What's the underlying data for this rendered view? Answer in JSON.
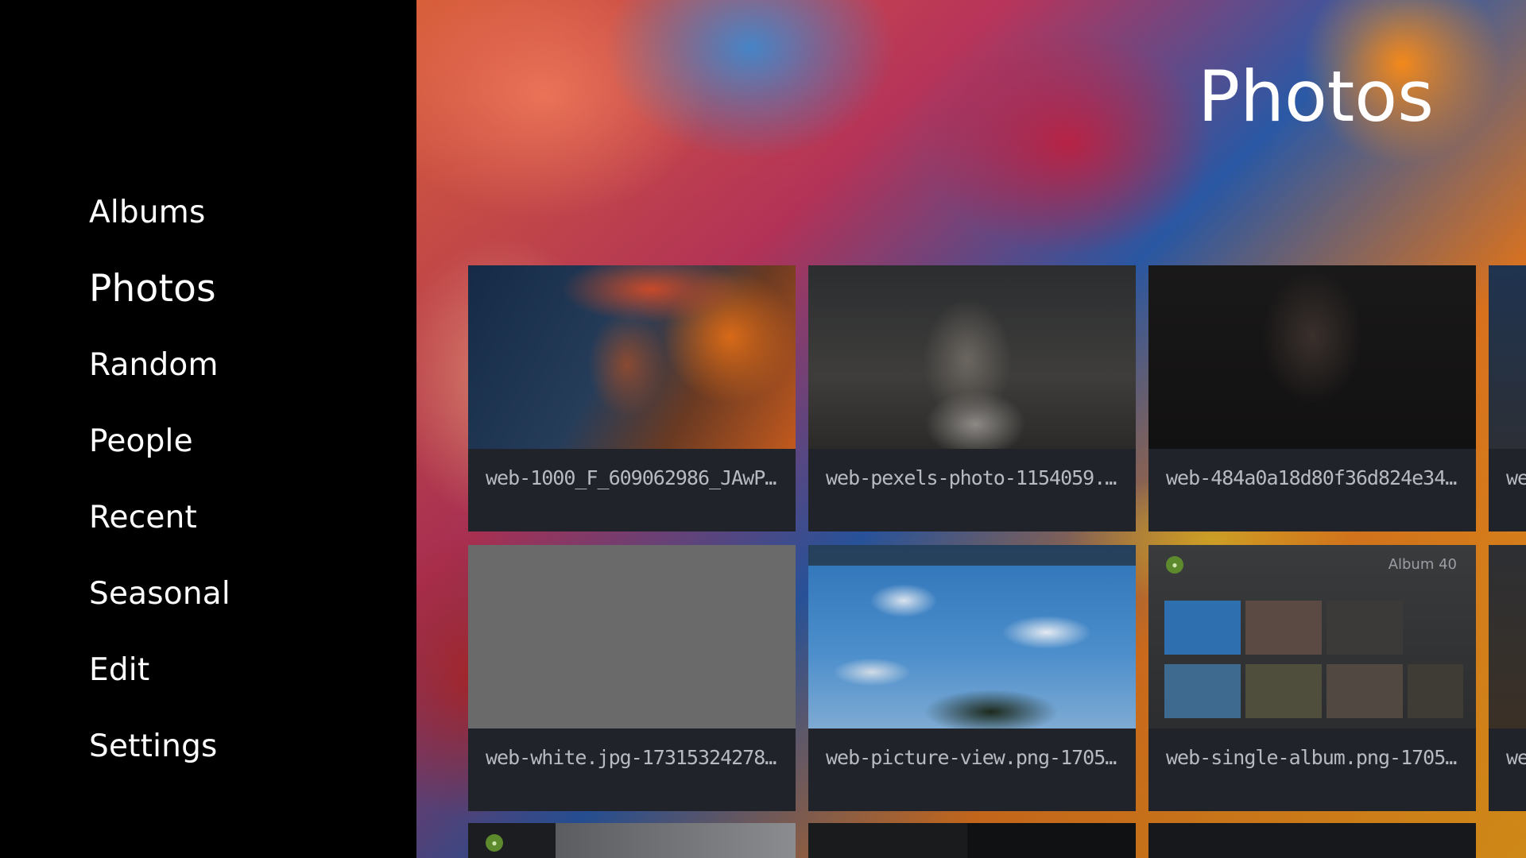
{
  "nav": {
    "items": [
      {
        "label": "Albums",
        "active": false
      },
      {
        "label": "Photos",
        "active": true
      },
      {
        "label": "Random",
        "active": false
      },
      {
        "label": "People",
        "active": false
      },
      {
        "label": "Recent",
        "active": false
      },
      {
        "label": "Seasonal",
        "active": false
      },
      {
        "label": "Edit",
        "active": false
      },
      {
        "label": "Settings",
        "active": false
      }
    ]
  },
  "page": {
    "title": "Photos"
  },
  "photos": [
    {
      "caption": "web-1000_F_609062986_JAwP..."
    },
    {
      "caption": "web-pexels-photo-1154059.jpe..."
    },
    {
      "caption": "web-484a0a18d80f36d824e34c..."
    },
    {
      "caption": "web-white.jpg-1731532427838"
    },
    {
      "caption": "web-picture-view.png-1705754..."
    },
    {
      "caption": "web-single-album.png-1705754...",
      "thumb_label": "Album 40"
    }
  ],
  "peek_captions": [
    "we",
    "we"
  ],
  "colors": {
    "sidebar_bg": "#000000",
    "card_bg": "#20242a",
    "caption_text": "#b7bbc1"
  }
}
